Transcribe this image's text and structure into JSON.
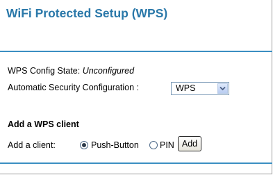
{
  "page": {
    "title": "WiFi Protected Setup (WPS)"
  },
  "config": {
    "state_label": "WPS Config State:",
    "state_value": "Unconfigured",
    "auto_security_label": "Automatic Security Configuration :",
    "auto_security_selected": "WPS"
  },
  "add_client": {
    "heading": "Add a WPS client",
    "prompt_label": "Add a client:",
    "options": [
      {
        "label": "Push-Button",
        "selected": true
      },
      {
        "label": "PIN",
        "selected": false
      }
    ],
    "add_button_label": "Add"
  },
  "colors": {
    "title": "#2a78a9",
    "rule": "#3b8fc2"
  },
  "icons": {
    "dropdown": "chevron-down-icon"
  }
}
